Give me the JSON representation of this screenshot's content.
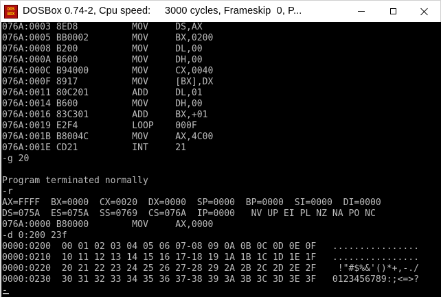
{
  "window": {
    "title": "DOSBox 0.74-2, Cpu speed:     3000 cycles, Frameskip  0, P...",
    "icon_name": "dosbox-icon",
    "icon_text_top": "DOS",
    "icon_text_bottom": "BOX",
    "colors": {
      "titlebar_bg": "#ffffff",
      "console_bg": "#000000",
      "console_fg": "#bcbcbc",
      "icon_bg": "#b01010",
      "icon_fg": "#ffd800"
    }
  },
  "console": {
    "lines": [
      "076A:0003 8ED8          MOV     DS,AX",
      "076A:0005 BB0002        MOV     BX,0200",
      "076A:0008 B200          MOV     DL,00",
      "076A:000A B600          MOV     DH,00",
      "076A:000C B94000        MOV     CX,0040",
      "076A:000F 8917          MOV     [BX],DX",
      "076A:0011 80C201        ADD     DL,01",
      "076A:0014 B600          MOV     DH,00",
      "076A:0016 83C301        ADD     BX,+01",
      "076A:0019 E2F4          LOOP    000F",
      "076A:001B B8004C        MOV     AX,4C00",
      "076A:001E CD21          INT     21",
      "-g 20",
      "",
      "Program terminated normally",
      "-r",
      "AX=FFFF  BX=0000  CX=0020  DX=0000  SP=0000  BP=0000  SI=0000  DI=0000",
      "DS=075A  ES=075A  SS=0769  CS=076A  IP=0000   NV UP EI PL NZ NA PO NC",
      "076A:0000 B80000        MOV     AX,0000",
      "-d 0:200 23f",
      "0000:0200  00 01 02 03 04 05 06 07-08 09 0A 0B 0C 0D 0E 0F   ................",
      "0000:0210  10 11 12 13 14 15 16 17-18 19 1A 1B 1C 1D 1E 1F   ................",
      "0000:0220  20 21 22 23 24 25 26 27-28 29 2A 2B 2C 2D 2E 2F    !\"#$%&'()*+,-./",
      "0000:0230  30 31 32 33 34 35 36 37-38 39 3A 3B 3C 3D 3E 3F   0123456789:;<=>?",
      "-"
    ]
  }
}
